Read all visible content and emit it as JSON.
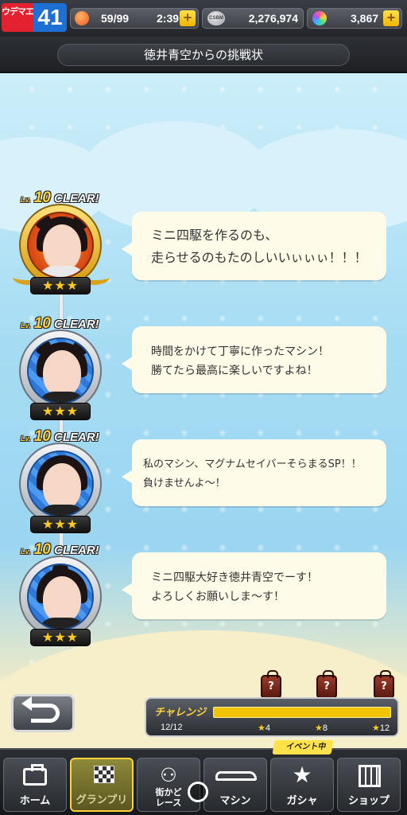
{
  "status": {
    "rank_label": "ウデマエ",
    "rank_value": "41",
    "stamina": "59/99",
    "timer": "2:39",
    "coins": "2,276,974",
    "gems": "3,867",
    "coin_icon_text": "CSBM"
  },
  "title": "徳井青空からの挑戦状",
  "stages": [
    {
      "badge_lv": "Lv.",
      "badge_num": "10",
      "badge_text": "CLEAR!",
      "stars": "★★★",
      "lines": [
        "ミニ四駆を作るのも、",
        "走らせるのもたのしいいぃぃぃ！！！"
      ]
    },
    {
      "badge_lv": "Lv.",
      "badge_num": "10",
      "badge_text": "CLEAR!",
      "stars": "★★★",
      "lines": [
        "時間をかけて丁寧に作ったマシン！",
        "勝てたら最高に楽しいですよね！"
      ]
    },
    {
      "badge_lv": "Lv.",
      "badge_num": "10",
      "badge_text": "CLEAR!",
      "stars": "★★★",
      "lines": [
        "私のマシン、マグナムセイバーそらまるSP！！",
        "負けませんよ～！"
      ]
    },
    {
      "badge_lv": "Lv.",
      "badge_num": "10",
      "badge_text": "CLEAR!",
      "stars": "★★★",
      "lines": [
        "ミニ四駆大好き徳井青空でーす！",
        "よろしくお願いしま～す！"
      ]
    }
  ],
  "challenge": {
    "label": "チャレンジ",
    "count": "12/12",
    "progress": 1.0,
    "marks": [
      "4",
      "8",
      "12"
    ],
    "reward_icon": "?"
  },
  "nav": {
    "event_tag": "イベント中",
    "items": [
      {
        "label": "ホーム",
        "icon": "toolbox-icon"
      },
      {
        "label": "グランプリ",
        "icon": "checkered-flag-icon"
      },
      {
        "label": "街かど\nレース",
        "icon": "people-icon"
      },
      {
        "label": "マシン",
        "icon": "car-icon"
      },
      {
        "label": "ガシャ",
        "icon": "star-icon"
      },
      {
        "label": "ショップ",
        "icon": "shop-icon"
      }
    ]
  }
}
